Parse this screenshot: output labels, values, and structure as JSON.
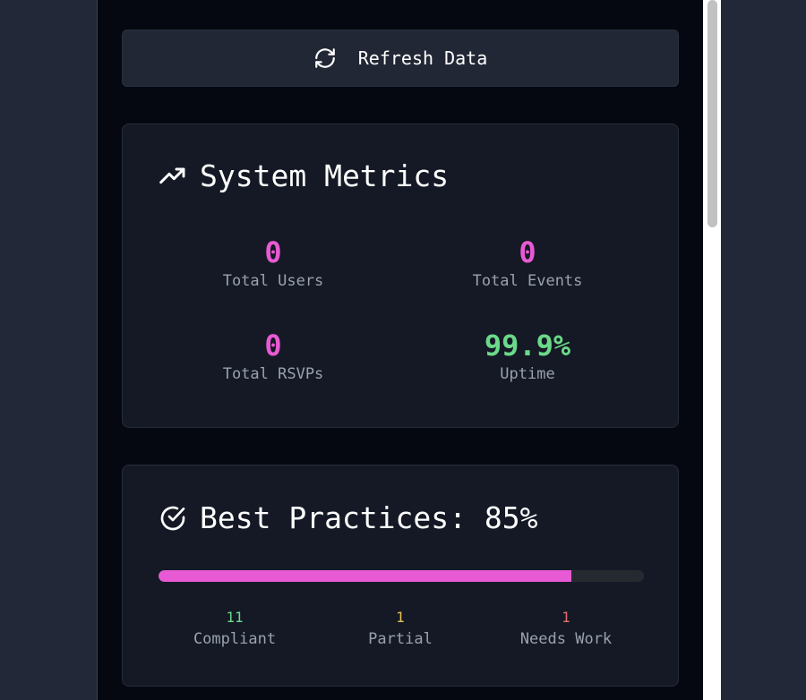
{
  "refresh": {
    "label": "Refresh Data",
    "icon": "refresh-icon"
  },
  "metrics": {
    "title": "System Metrics",
    "icon": "trending-up-icon",
    "items": [
      {
        "value": "0",
        "label": "Total Users"
      },
      {
        "value": "0",
        "label": "Total Events"
      },
      {
        "value": "0",
        "label": "Total RSVPs"
      },
      {
        "value": "99.9%",
        "label": "Uptime"
      }
    ]
  },
  "practices": {
    "title": "Best Practices: 85%",
    "icon": "check-circle-icon",
    "progress_percent": 85,
    "stats": [
      {
        "count": "11",
        "label": "Compliant"
      },
      {
        "count": "1",
        "label": "Partial"
      },
      {
        "count": "1",
        "label": "Needs Work"
      }
    ]
  },
  "colors": {
    "accent": "#e85ad3",
    "success": "#6bd98a",
    "warning": "#e8c05a",
    "danger": "#e86a6a"
  }
}
